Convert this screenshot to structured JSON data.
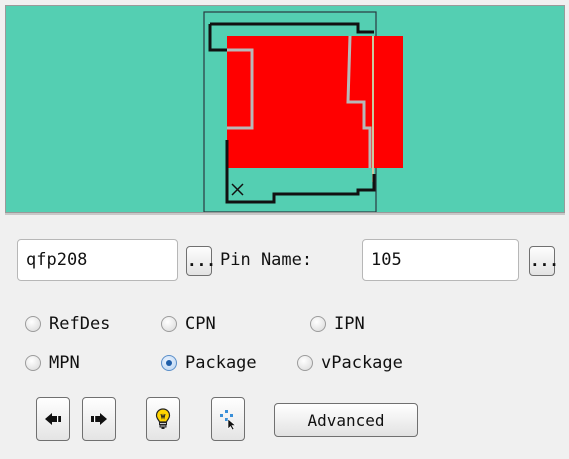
{
  "preview": {
    "background": "#54cfb2",
    "highlight_color": "#ff0000",
    "outline_color": "#111111"
  },
  "search": {
    "part_value": "qfp208",
    "browse_label": "...",
    "pin_label": "Pin Name:",
    "pin_value": "105",
    "pin_browse_label": "..."
  },
  "filters": {
    "options": [
      {
        "label": "RefDes",
        "checked": false
      },
      {
        "label": "CPN",
        "checked": false
      },
      {
        "label": "IPN",
        "checked": false
      },
      {
        "label": "MPN",
        "checked": false
      },
      {
        "label": "Package",
        "checked": true
      },
      {
        "label": "vPackage",
        "checked": false
      }
    ]
  },
  "toolbar": {
    "back_icon": "arrow-left-icon",
    "forward_icon": "arrow-right-icon",
    "hint_icon": "lightbulb-icon",
    "select_icon": "cursor-select-icon",
    "advanced_label": "Advanced"
  }
}
